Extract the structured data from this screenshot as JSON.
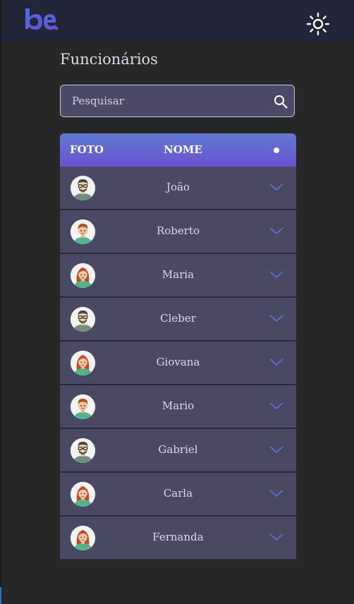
{
  "header": {
    "logo_icon": "be-logo",
    "theme_toggle_icon": "sun-icon"
  },
  "page": {
    "title": "Funcionários"
  },
  "search": {
    "placeholder": "Pesquisar",
    "icon": "search-icon"
  },
  "table": {
    "columns": {
      "photo": "FOTO",
      "name": "NOME",
      "options": "•"
    },
    "rows": [
      {
        "name": "João",
        "avatar": "man-glasses-icon"
      },
      {
        "name": "Roberto",
        "avatar": "boy-icon"
      },
      {
        "name": "Maria",
        "avatar": "woman-icon"
      },
      {
        "name": "Cleber",
        "avatar": "man-glasses-icon"
      },
      {
        "name": "Giovana",
        "avatar": "woman-icon"
      },
      {
        "name": "Mario",
        "avatar": "boy-icon"
      },
      {
        "name": "Gabriel",
        "avatar": "man-glasses-icon"
      },
      {
        "name": "Carla",
        "avatar": "woman-icon"
      },
      {
        "name": "Fernanda",
        "avatar": "woman-icon"
      }
    ]
  },
  "colors": {
    "background": "#272727",
    "topbar": "#222438",
    "row": "#4a4964",
    "header_gradient_start": "#5f7bd0",
    "header_gradient_end": "#6a52d2",
    "chevron": "#5a72e6"
  }
}
